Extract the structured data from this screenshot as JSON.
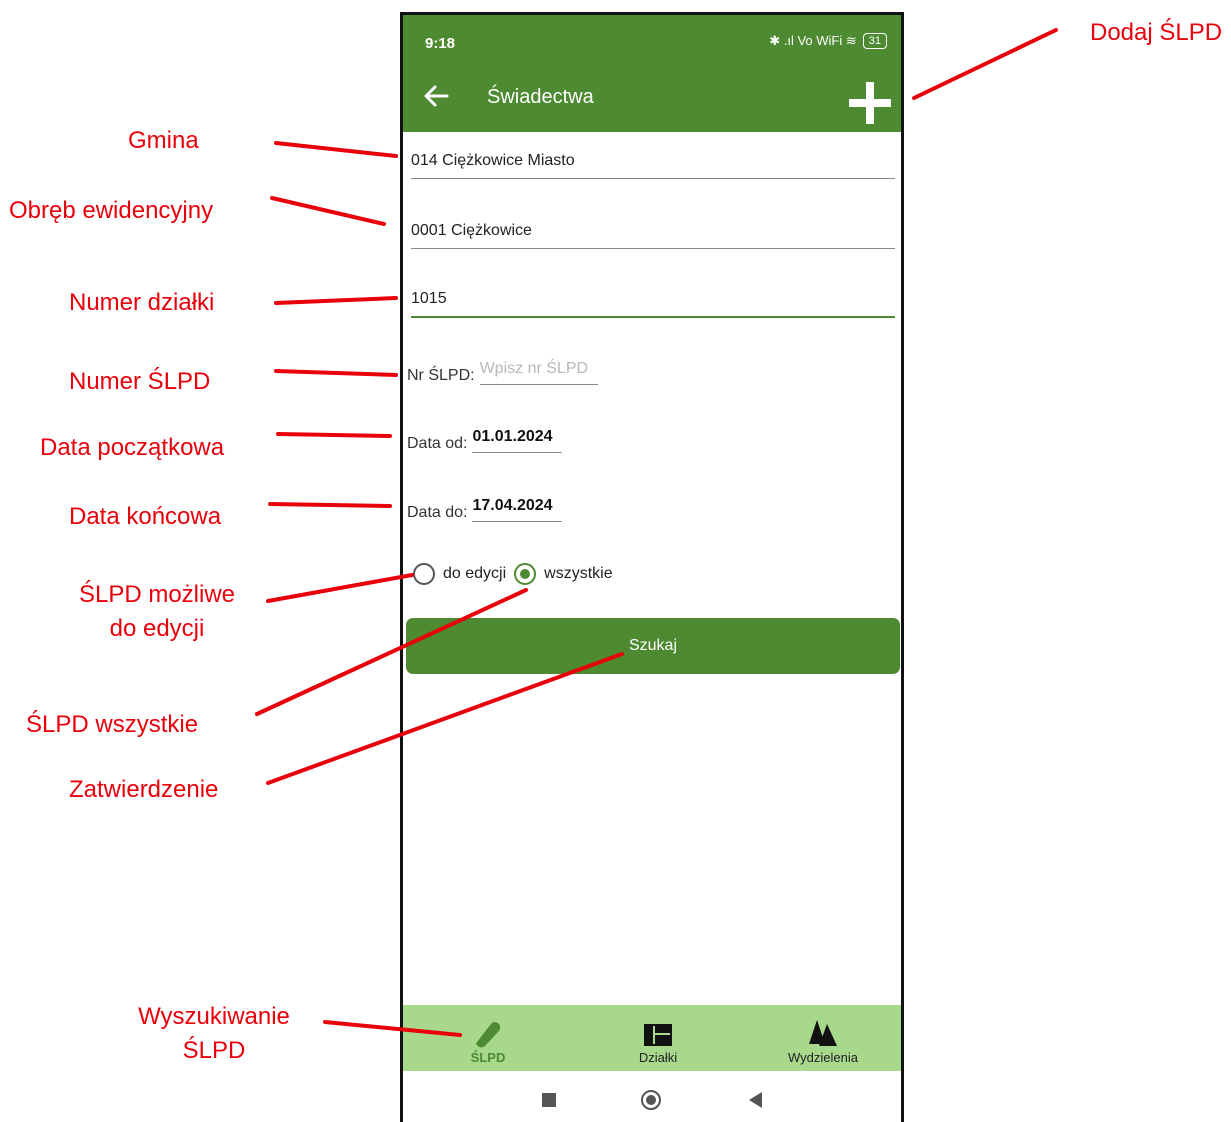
{
  "status_bar": {
    "time": "9:18",
    "icons_text": "✱ .ıl Vo WiFi ≋",
    "battery": "31"
  },
  "app_bar": {
    "title": "Świadectwa"
  },
  "form": {
    "gmina": "014 Ciężkowice Miasto",
    "obreb": "0001 Ciężkowice",
    "numer_dzialki": "1015",
    "nr_slpd_label": "Nr ŚLPD:",
    "nr_slpd_placeholder": "Wpisz nr ŚLPD",
    "data_od_label": "Data od:",
    "data_od": "01.01.2024",
    "data_do_label": "Data do:",
    "data_do": "17.04.2024",
    "radio_do_edycji": "do edycji",
    "radio_wszystkie": "wszystkie",
    "search_button": "Szukaj"
  },
  "bottom_nav": [
    {
      "label": "ŚLPD",
      "icon": "slpd-icon",
      "active": true
    },
    {
      "label": "Działki",
      "icon": "parcels-icon",
      "active": false
    },
    {
      "label": "Wydzielenia",
      "icon": "trees-icon",
      "active": false
    }
  ],
  "annotations": {
    "dodaj": "Dodaj ŚLPD",
    "gmina": "Gmina",
    "obreb": "Obręb ewidencyjny",
    "numer_dzialki": "Numer działki",
    "numer_slpd": "Numer ŚLPD",
    "data_poczatkowa": "Data początkowa",
    "data_koncowa": "Data końcowa",
    "slpd_mozliwe_1": "ŚLPD możliwe",
    "slpd_mozliwe_2": "do edycji",
    "slpd_wszystkie": "ŚLPD wszystkie",
    "zatwierdzenie": "Zatwierdzenie",
    "wyszukiwanie_1": "Wyszukiwanie",
    "wyszukiwanie_2": "ŚLPD"
  },
  "colors": {
    "primary": "#4d8a31",
    "nav_bg": "#a8d88c",
    "annotation": "#e8000a"
  }
}
